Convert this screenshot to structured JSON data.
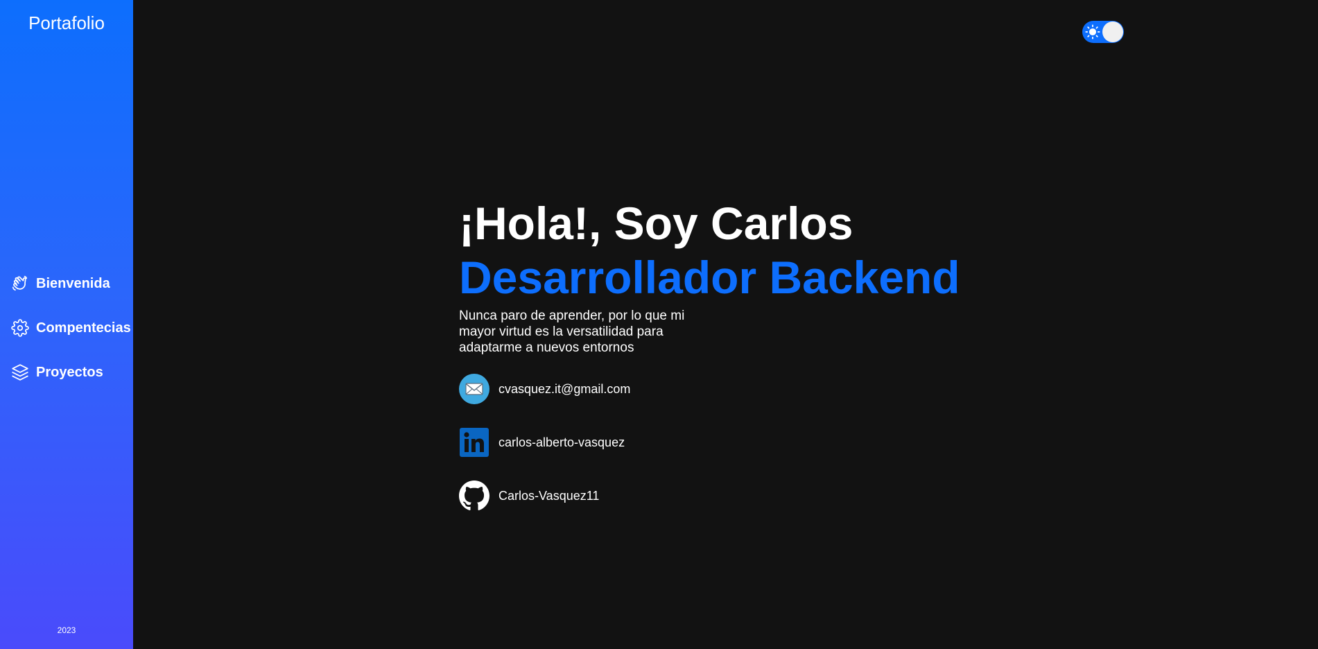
{
  "sidebar": {
    "brand": "Portafolio",
    "items": [
      {
        "label": "Bienvenida",
        "icon": "waving-hand-icon"
      },
      {
        "label": "Compentecias",
        "icon": "gear-icon"
      },
      {
        "label": "Proyectos",
        "icon": "layers-icon"
      }
    ],
    "year": "2023"
  },
  "theme_toggle": {
    "icon": "sun-icon",
    "state": "on"
  },
  "hero": {
    "greeting": "¡Hola!, Soy Carlos",
    "role": "Desarrollador Backend",
    "tagline": "Nunca paro de aprender, por lo que mi mayor virtud es la versatilidad para adaptarme a nuevos entornos"
  },
  "contacts": [
    {
      "text": "cvasquez.it@gmail.com",
      "icon": "envelope-icon"
    },
    {
      "text": "carlos-alberto-vasquez",
      "icon": "linkedin-icon"
    },
    {
      "text": "Carlos-Vasquez11",
      "icon": "github-icon"
    }
  ],
  "colors": {
    "accent": "#0d6efd",
    "background": "#121212",
    "sidebar_top": "#0d6efd",
    "sidebar_bottom": "#4a4bfb",
    "text": "#ffffff"
  }
}
